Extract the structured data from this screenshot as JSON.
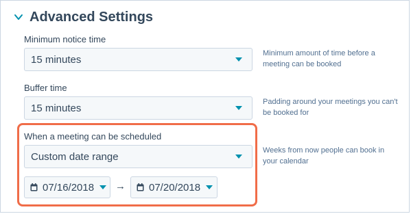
{
  "section": {
    "title": "Advanced Settings"
  },
  "min_notice": {
    "label": "Minimum notice time",
    "value": "15 minutes",
    "help": "Minimum amount of time before a meeting can be booked"
  },
  "buffer": {
    "label": "Buffer time",
    "value": "15 minutes",
    "help": "Padding around your meetings you can't be booked for"
  },
  "schedule": {
    "label": "When a meeting can be scheduled",
    "value": "Custom date range",
    "help": "Weeks from now people can book in your calendar",
    "start_date": "07/16/2018",
    "end_date": "07/20/2018",
    "range_arrow": "→"
  },
  "colors": {
    "accent": "#0091ae",
    "highlight": "#f06c48"
  },
  "icons": {
    "collapse": "chevron-down-icon",
    "calendar": "calendar-icon",
    "dropdown": "caret-down-icon"
  }
}
